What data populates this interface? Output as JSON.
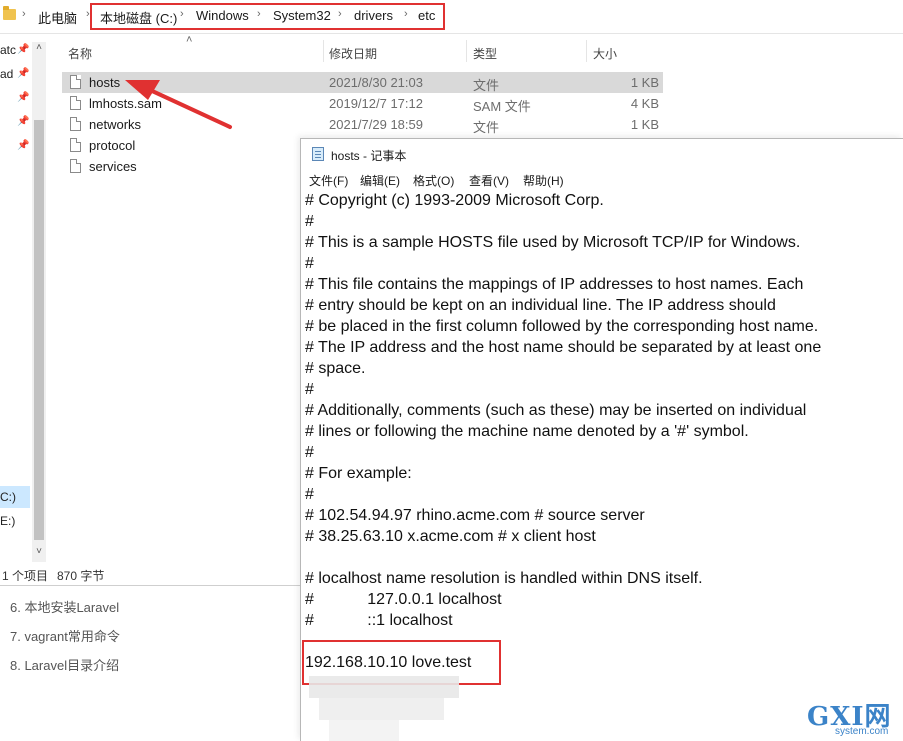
{
  "explorer": {
    "breadcrumb": [
      "此电脑",
      "本地磁盘 (C:)",
      "Windows",
      "System32",
      "drivers",
      "etc"
    ],
    "nav_fragments": [
      "atc",
      "ad",
      "C:)",
      "E:)"
    ],
    "columns": {
      "name": "名称",
      "date": "修改日期",
      "type": "类型",
      "size": "大小"
    },
    "files": [
      {
        "name": "hosts",
        "date": "2021/8/30 21:03",
        "type": "文件",
        "size": "1 KB",
        "selected": true
      },
      {
        "name": "lmhosts.sam",
        "date": "2019/12/7 17:12",
        "type": "SAM 文件",
        "size": "4 KB"
      },
      {
        "name": "networks",
        "date": "2021/7/29 18:59",
        "type": "文件",
        "size": "1 KB"
      },
      {
        "name": "protocol",
        "date": "",
        "type": "",
        "size": ""
      },
      {
        "name": "services",
        "date": "",
        "type": "",
        "size": ""
      }
    ],
    "status": {
      "count": "1 个项目",
      "size": "870 字节"
    }
  },
  "article_nav": [
    "6. 本地安装Laravel",
    "7. vagrant常用命令",
    "8. Laravel目录介绍"
  ],
  "notepad": {
    "title": "hosts - 记事本",
    "menu": [
      "文件(F)",
      "编辑(E)",
      "格式(O)",
      "查看(V)",
      "帮助(H)"
    ],
    "lines": [
      "# Copyright (c) 1993-2009 Microsoft Corp.",
      "#",
      "# This is a sample HOSTS file used by Microsoft TCP/IP for Windows.",
      "#",
      "# This file contains the mappings of IP addresses to host names. Each",
      "# entry should be kept on an individual line. The IP address should",
      "# be placed in the first column followed by the corresponding host name.",
      "# The IP address and the host name should be separated by at least one",
      "# space.",
      "#",
      "# Additionally, comments (such as these) may be inserted on individual",
      "# lines or following the machine name denoted by a '#' symbol.",
      "#",
      "# For example:",
      "#",
      "# 102.54.94.97 rhino.acme.com # source server",
      "# 38.25.63.10 x.acme.com # x client host",
      "",
      "# localhost name resolution is handled within DNS itself.",
      "#            127.0.0.1 localhost",
      "#            ::1 localhost",
      "",
      "192.168.10.10 love.test"
    ]
  },
  "watermark": {
    "brand": "GXI网",
    "site": "system.com"
  },
  "colors": {
    "highlight": "#e03131",
    "selection": "#d9d9d9",
    "watermark": "#3b83c8"
  },
  "icons": [
    "folder-icon",
    "pin-icon",
    "file-icon",
    "notepad-icon",
    "arrow-annotation"
  ]
}
